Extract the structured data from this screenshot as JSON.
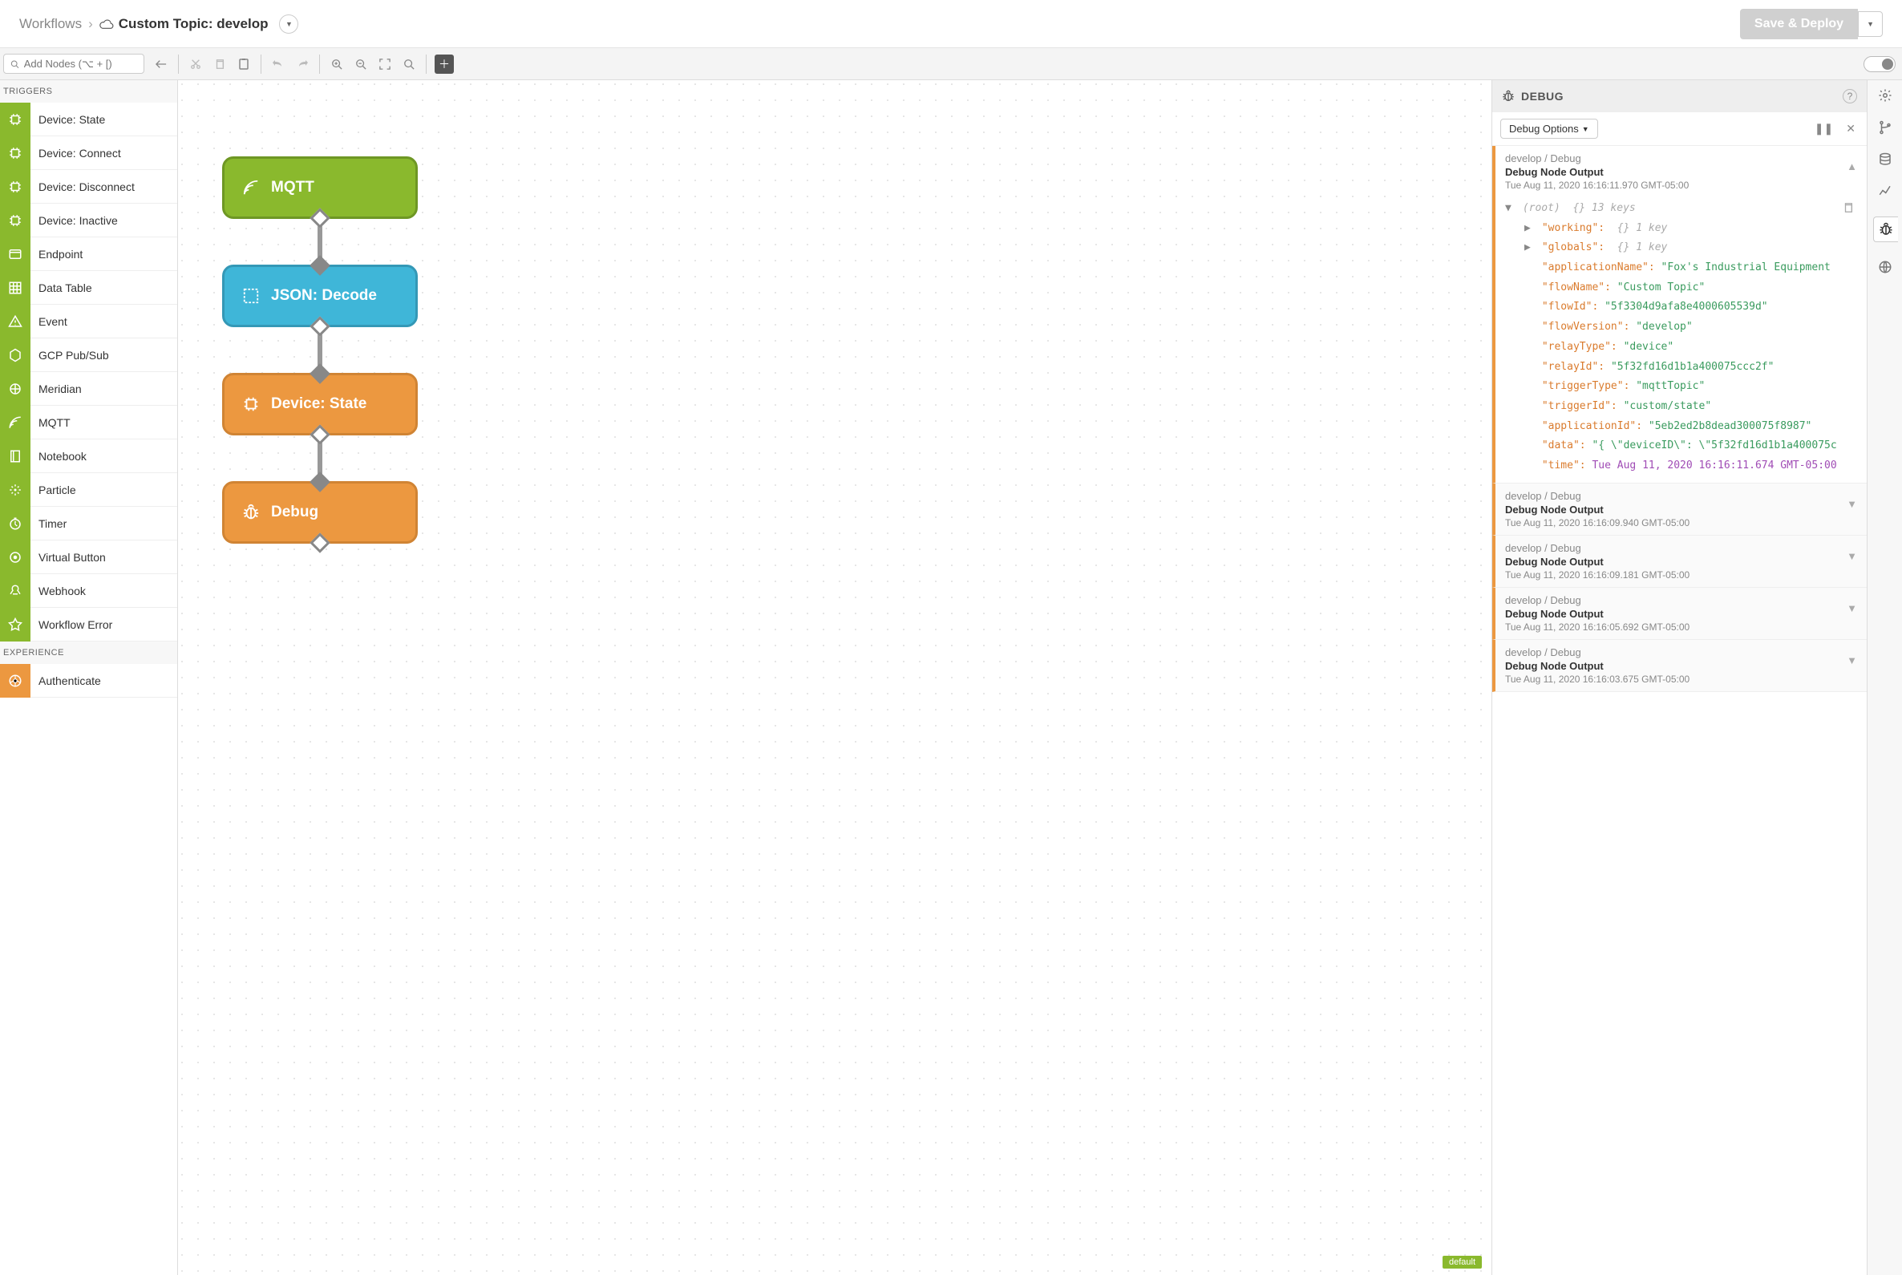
{
  "header": {
    "breadcrumb_root": "Workflows",
    "title": "Custom Topic: develop",
    "save_label": "Save & Deploy"
  },
  "toolbar": {
    "search_placeholder": "Add Nodes (⌥ + [)"
  },
  "sidebar": {
    "section_triggers": "TRIGGERS",
    "section_experience": "EXPERIENCE",
    "triggers": [
      "Device: State",
      "Device: Connect",
      "Device: Disconnect",
      "Device: Inactive",
      "Endpoint",
      "Data Table",
      "Event",
      "GCP Pub/Sub",
      "Meridian",
      "MQTT",
      "Notebook",
      "Particle",
      "Timer",
      "Virtual Button",
      "Webhook",
      "Workflow Error"
    ],
    "experience": [
      "Authenticate"
    ]
  },
  "canvas": {
    "nodes": {
      "mqtt": "MQTT",
      "json": "JSON: Decode",
      "state": "Device: State",
      "debug": "Debug"
    },
    "default_tag": "default"
  },
  "debug": {
    "header": "DEBUG",
    "options_label": "Debug Options",
    "entries": [
      {
        "path": "develop / Debug",
        "title": "Debug Node Output",
        "time": "Tue Aug 11, 2020 16:16:11.970 GMT-05:00",
        "expanded": true
      },
      {
        "path": "develop / Debug",
        "title": "Debug Node Output",
        "time": "Tue Aug 11, 2020 16:16:09.940 GMT-05:00",
        "expanded": false
      },
      {
        "path": "develop / Debug",
        "title": "Debug Node Output",
        "time": "Tue Aug 11, 2020 16:16:09.181 GMT-05:00",
        "expanded": false
      },
      {
        "path": "develop / Debug",
        "title": "Debug Node Output",
        "time": "Tue Aug 11, 2020 16:16:05.692 GMT-05:00",
        "expanded": false
      },
      {
        "path": "develop / Debug",
        "title": "Debug Node Output",
        "time": "Tue Aug 11, 2020 16:16:03.675 GMT-05:00",
        "expanded": false
      }
    ],
    "tree": {
      "root_label": "(root)",
      "root_meta": "{}  13 keys",
      "working_key": "\"working\":",
      "working_meta": "{}  1 key",
      "globals_key": "\"globals\":",
      "globals_meta": "{}  1 key",
      "rows": [
        {
          "k": "\"applicationName\":",
          "v": "\"Fox's Industrial Equipment",
          "cls": "json-str"
        },
        {
          "k": "\"flowName\":",
          "v": "\"Custom Topic\"",
          "cls": "json-str"
        },
        {
          "k": "\"flowId\":",
          "v": "\"5f3304d9afa8e4000605539d\"",
          "cls": "json-str"
        },
        {
          "k": "\"flowVersion\":",
          "v": "\"develop\"",
          "cls": "json-str"
        },
        {
          "k": "\"relayType\":",
          "v": "\"device\"",
          "cls": "json-str"
        },
        {
          "k": "\"relayId\":",
          "v": "\"5f32fd16d1b1a400075ccc2f\"",
          "cls": "json-str"
        },
        {
          "k": "\"triggerType\":",
          "v": "\"mqttTopic\"",
          "cls": "json-str"
        },
        {
          "k": "\"triggerId\":",
          "v": "\"custom/state\"",
          "cls": "json-str"
        },
        {
          "k": "\"applicationId\":",
          "v": "\"5eb2ed2b8dead300075f8987\"",
          "cls": "json-str"
        },
        {
          "k": "\"data\":",
          "v": "\"{ \\\"deviceID\\\": \\\"5f32fd16d1b1a400075c",
          "cls": "json-str"
        },
        {
          "k": "\"time\":",
          "v": "Tue Aug 11, 2020 16:16:11.674 GMT-05:00",
          "cls": "json-val"
        }
      ]
    }
  }
}
